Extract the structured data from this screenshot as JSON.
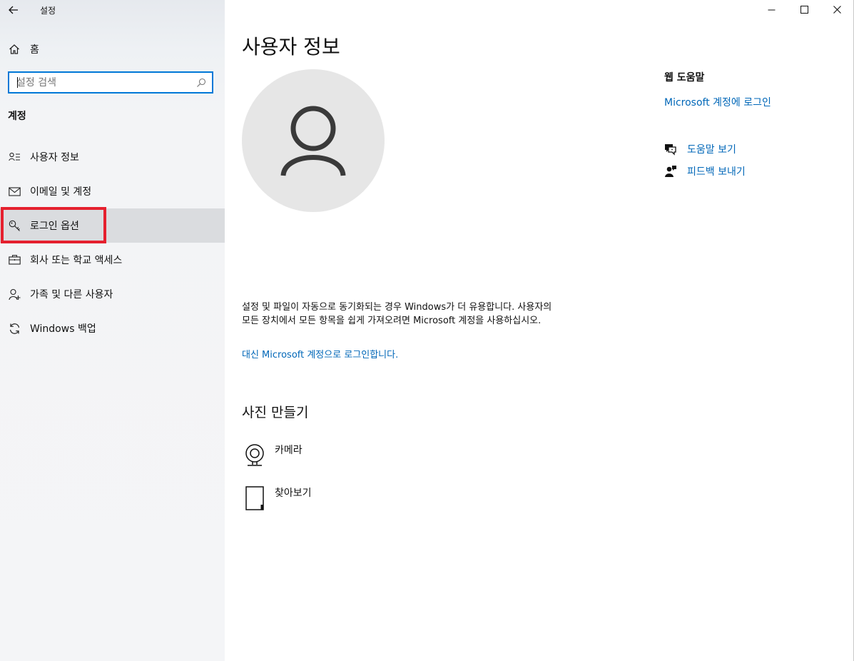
{
  "window": {
    "app_title": "설정",
    "controls": [
      "minimize",
      "maximize",
      "close"
    ]
  },
  "sidebar": {
    "home_label": "홈",
    "search": {
      "placeholder": "설정 검색",
      "value": ""
    },
    "section_title": "계정",
    "items": [
      {
        "label": "사용자 정보",
        "icon": "user-info-icon",
        "selected": false
      },
      {
        "label": "이메일 및 계정",
        "icon": "mail-icon",
        "selected": false
      },
      {
        "label": "로그인 옵션",
        "icon": "key-icon",
        "selected": true
      },
      {
        "label": "회사 또는 학교 액세스",
        "icon": "briefcase-icon",
        "selected": false
      },
      {
        "label": "가족 및 다른 사용자",
        "icon": "person-add-icon",
        "selected": false
      },
      {
        "label": "Windows 백업",
        "icon": "sync-icon",
        "selected": false
      }
    ]
  },
  "main": {
    "title": "사용자 정보",
    "info_text": "설정 및 파일이 자동으로 동기화되는 경우 Windows가 더 유용합니다. 사용자의 모든 장치에서 모든 항목을 쉽게 가져오려면 Microsoft 계정을 사용하십시오.",
    "signin_link": "대신 Microsoft 계정으로 로그인합니다.",
    "photo_section_title": "사진 만들기",
    "photo_options": [
      {
        "label": "카메라",
        "icon": "webcam-icon"
      },
      {
        "label": "찾아보기",
        "icon": "browse-file-icon"
      }
    ]
  },
  "help": {
    "title": "웹 도움말",
    "ms_link": "Microsoft 계정에 로그인",
    "actions": [
      {
        "label": "도움말 보기",
        "icon": "help-chat-icon"
      },
      {
        "label": "피드백 보내기",
        "icon": "feedback-icon"
      }
    ]
  },
  "colors": {
    "accent": "#0078d7",
    "link": "#0067b8",
    "highlight": "#e5202e",
    "selected_bg": "#dadcdf"
  }
}
